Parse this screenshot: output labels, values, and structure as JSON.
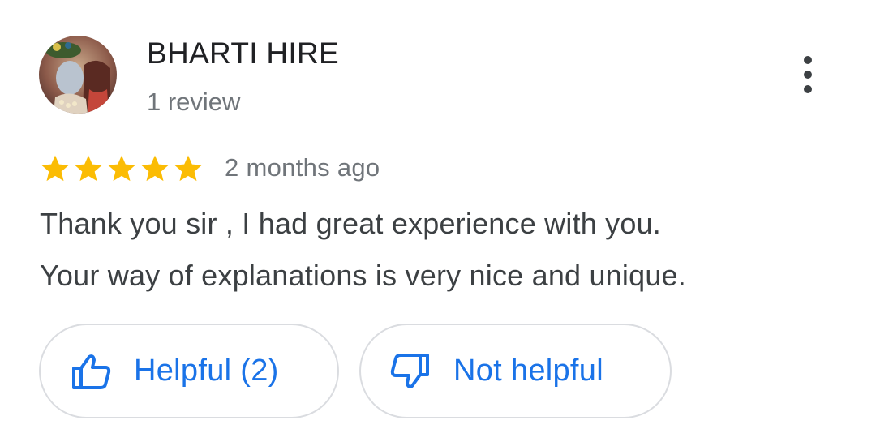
{
  "review": {
    "reviewer_name": "BHARTI HIRE",
    "review_count": "1 review",
    "rating": 5,
    "rating_max": 5,
    "time": "2 months ago",
    "text_lines": [
      "Thank you sir , I had great experience with you.",
      "Your way of explanations is very nice and unique."
    ]
  },
  "actions": {
    "helpful_label": "Helpful (2)",
    "not_helpful_label": "Not helpful",
    "more_icon": "more-vert-icon",
    "helpful_icon": "thumb-up-icon",
    "not_helpful_icon": "thumb-down-icon"
  },
  "colors": {
    "star": "#fbbc04",
    "accent": "#1a73e8",
    "name": "#202124",
    "meta": "#70757a",
    "body": "#3c4043",
    "border": "#dadce0"
  }
}
